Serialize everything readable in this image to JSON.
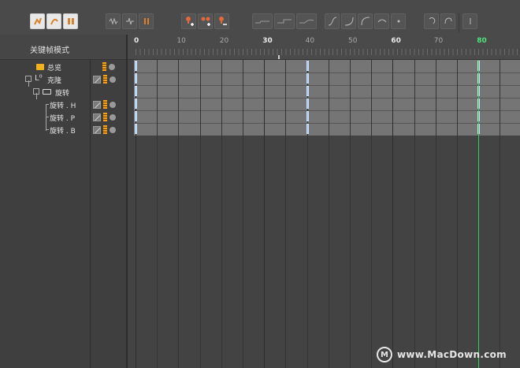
{
  "panel": {
    "title": "关键帧模式"
  },
  "toolbar": {
    "mode_buttons": [
      "key-edit-mode-icon",
      "fcurve-mode-icon",
      "motion-mode-icon"
    ],
    "key_buttons": [
      "add-key-icon",
      "add-key-all-icon",
      "delete-key-icon"
    ],
    "interp_buttons": [
      "step-icon",
      "linear-icon",
      "ease-icon"
    ]
  },
  "ruler": {
    "ticks": [
      {
        "label": "0",
        "major": true
      },
      {
        "label": "10",
        "major": false
      },
      {
        "label": "20",
        "major": false
      },
      {
        "label": "30",
        "major": true
      },
      {
        "label": "40",
        "major": false
      },
      {
        "label": "50",
        "major": false
      },
      {
        "label": "60",
        "major": true
      },
      {
        "label": "70",
        "major": false
      },
      {
        "label": "80",
        "current": true
      }
    ]
  },
  "objects": [
    {
      "label": "总览",
      "level": 0,
      "icon": "folder-icon"
    },
    {
      "label": "克隆",
      "level": 0,
      "icon": "cloner-icon"
    },
    {
      "label": "旋转",
      "level": 1,
      "icon": "folder-open-icon"
    },
    {
      "label": "旋转 . H",
      "level": 2
    },
    {
      "label": "旋转 . P",
      "level": 2
    },
    {
      "label": "旋转 . B",
      "level": 2
    }
  ],
  "keyframes": [
    0,
    40,
    80
  ],
  "current_frame": 80,
  "watermark": {
    "text": "www.MacDown.com",
    "logo": "M"
  },
  "colors": {
    "keyframe": "#9ec6ef",
    "playhead": "#2fd15b",
    "lock": "#f2a31b"
  }
}
